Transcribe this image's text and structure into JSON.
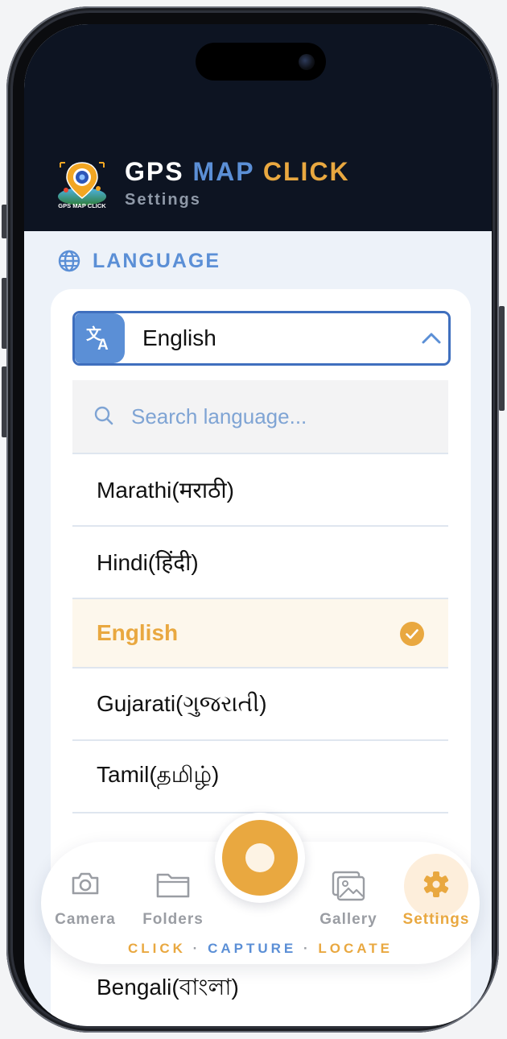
{
  "header": {
    "brand_word1": "GPS",
    "brand_word2": "MAP",
    "brand_word3": "CLICK",
    "subtitle": "Settings",
    "logo_text": "GPS MAP CLICK"
  },
  "language_section": {
    "title": "LANGUAGE",
    "selected_value": "English",
    "search_placeholder": "Search language...",
    "items": [
      {
        "label": "Marathi(मराठी)",
        "selected": false
      },
      {
        "label": "Hindi(हिंदी)",
        "selected": false
      },
      {
        "label": "English",
        "selected": true
      },
      {
        "label": "Gujarati(ગુજરાતી)",
        "selected": false
      },
      {
        "label": "Tamil(தமிழ்)",
        "selected": false
      },
      {
        "label": "Bengali(বাংলা)",
        "selected": false
      }
    ]
  },
  "bottom_nav": {
    "camera": "Camera",
    "folders": "Folders",
    "gallery": "Gallery",
    "settings": "Settings",
    "active": "settings",
    "tagline_1": "CLICK",
    "tagline_2": "CAPTURE",
    "tagline_3": "LOCATE",
    "tagline_sep": "·"
  },
  "colors": {
    "accent_orange": "#e9a840",
    "accent_blue": "#5b8fd6",
    "header_bg": "#0d1422",
    "content_bg": "#edf2f9"
  },
  "icons": [
    "globe-icon",
    "translate-icon",
    "chevron-up-icon",
    "search-icon",
    "check-circle-icon",
    "camera-icon",
    "folder-icon",
    "gallery-icon",
    "gear-icon"
  ]
}
